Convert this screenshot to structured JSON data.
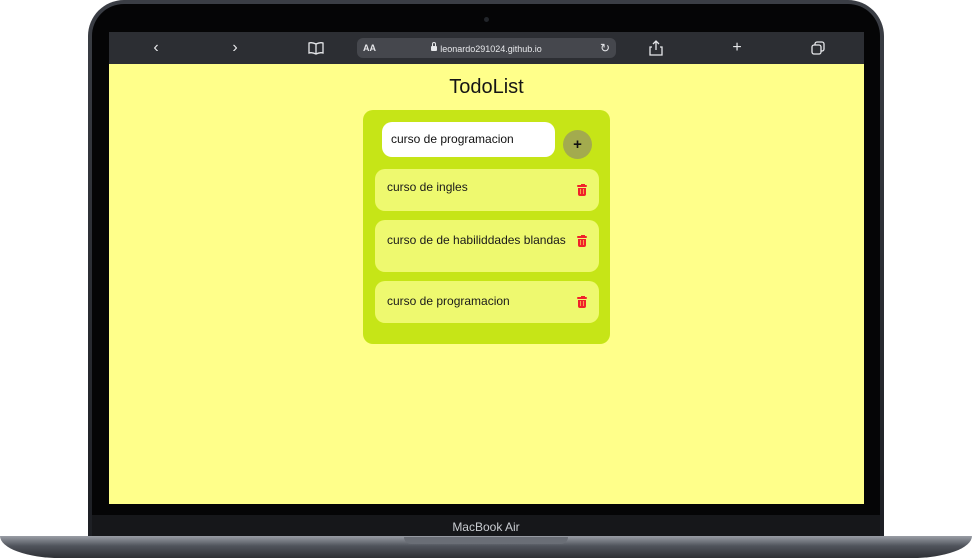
{
  "device": {
    "label": "MacBook Air"
  },
  "browser": {
    "back_icon": "‹",
    "forward_icon": "›",
    "bookmarks_icon": "book-icon",
    "text_size_label": "AA",
    "url": "leonardo291024.github.io",
    "reload_icon": "↻",
    "share_icon": "share-icon",
    "new_tab_icon": "+",
    "tabs_icon": "tabs-icon"
  },
  "app": {
    "title": "TodoList",
    "input_value": "curso de programacion",
    "add_label": "+",
    "colors": {
      "page_background": "#ffff8a",
      "card_background": "#c6e517",
      "item_background": "#eef96f",
      "delete_icon": "#f0222a"
    },
    "todos": [
      {
        "text": "curso de ingles"
      },
      {
        "text": "curso de de habiliddades blandas"
      },
      {
        "text": "curso de programacion"
      }
    ]
  }
}
